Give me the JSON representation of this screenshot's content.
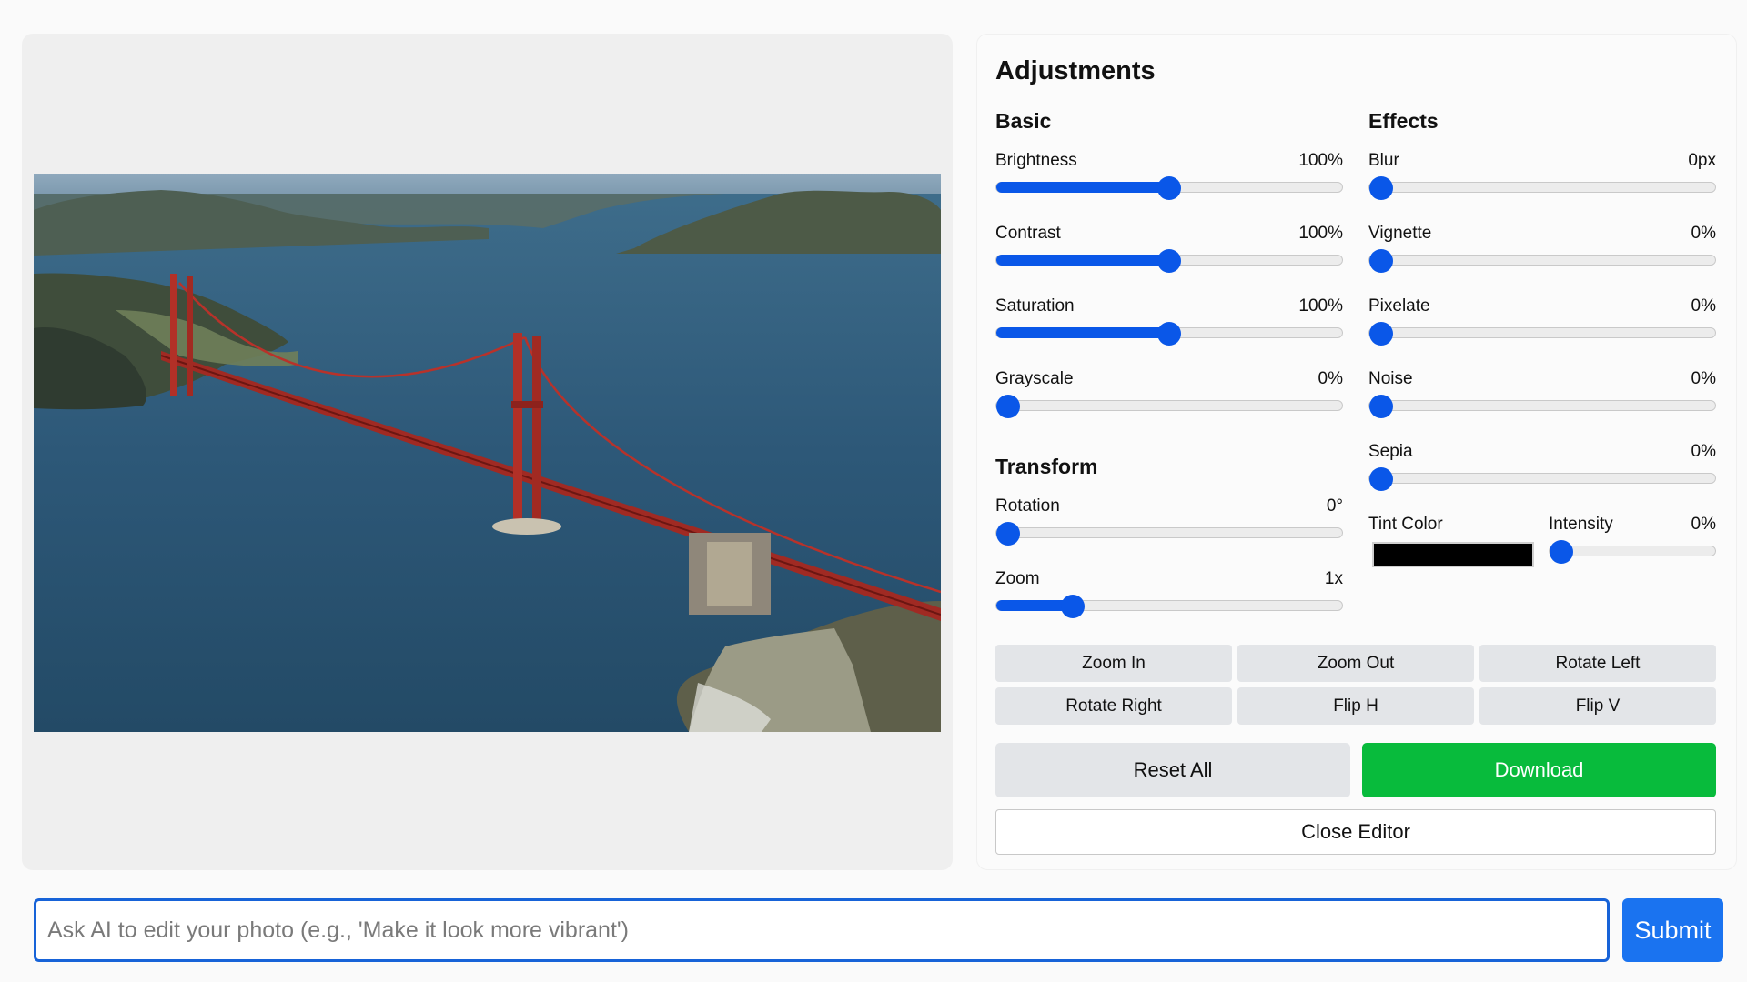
{
  "editor": {
    "photo_alt": "Aerial view of the Golden Gate Bridge over the bay"
  },
  "adjustments": {
    "title": "Adjustments",
    "basic": {
      "title": "Basic",
      "brightness": {
        "label": "Brightness",
        "value": "100%",
        "level": 0.5
      },
      "contrast": {
        "label": "Contrast",
        "value": "100%",
        "level": 0.5
      },
      "saturation": {
        "label": "Saturation",
        "value": "100%",
        "level": 0.5
      },
      "grayscale": {
        "label": "Grayscale",
        "value": "0%",
        "level": 0
      }
    },
    "transform": {
      "title": "Transform",
      "rotation": {
        "label": "Rotation",
        "value": "0°",
        "level": 0
      },
      "zoom": {
        "label": "Zoom",
        "value": "1x",
        "level": 0.2
      }
    },
    "effects": {
      "title": "Effects",
      "blur": {
        "label": "Blur",
        "value": "0px",
        "level": 0
      },
      "vignette": {
        "label": "Vignette",
        "value": "0%",
        "level": 0
      },
      "pixelate": {
        "label": "Pixelate",
        "value": "0%",
        "level": 0
      },
      "noise": {
        "label": "Noise",
        "value": "0%",
        "level": 0
      },
      "sepia": {
        "label": "Sepia",
        "value": "0%",
        "level": 0
      },
      "tint_color_label": "Tint Color",
      "tint_color": "#000000",
      "intensity": {
        "label": "Intensity",
        "value": "0%",
        "level": 0
      }
    }
  },
  "tools": {
    "zoom_in": "Zoom In",
    "zoom_out": "Zoom Out",
    "rotate_left": "Rotate Left",
    "rotate_right": "Rotate Right",
    "flip_h": "Flip H",
    "flip_v": "Flip V"
  },
  "actions": {
    "reset_all": "Reset All",
    "download": "Download",
    "close_editor": "Close Editor"
  },
  "ai_prompt": {
    "placeholder": "Ask AI to edit your photo (e.g., 'Make it look more vibrant')",
    "value": "",
    "submit": "Submit"
  },
  "colors": {
    "accent": "#0a57e8",
    "download": "#08bb3c",
    "submit": "#1a73f0"
  }
}
